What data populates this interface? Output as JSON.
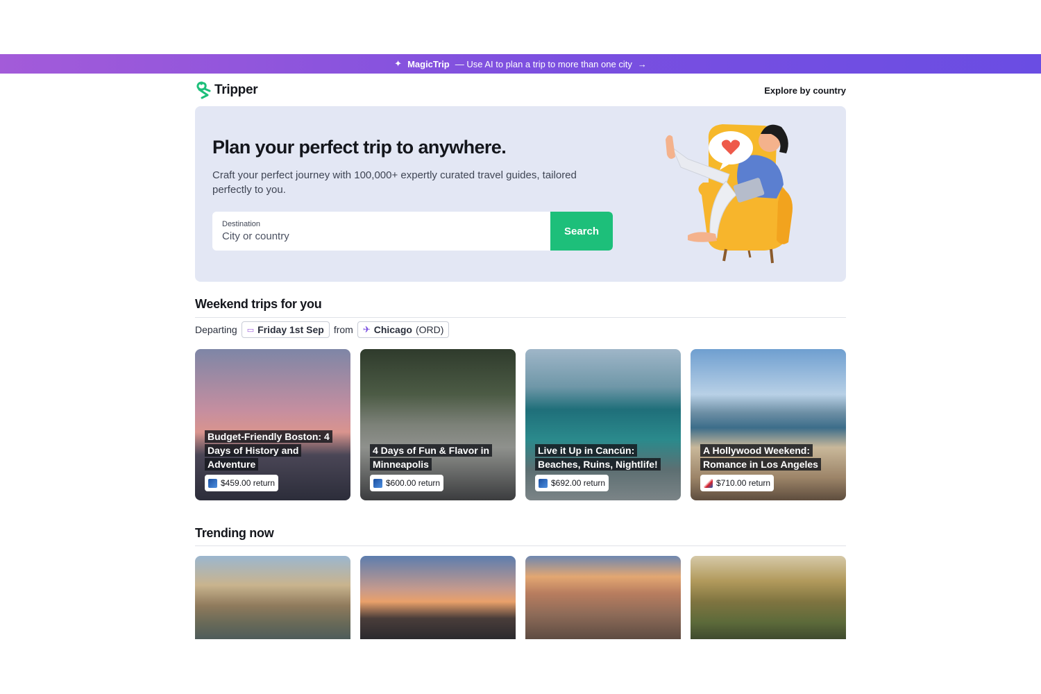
{
  "banner": {
    "brand": "MagicTrip",
    "text": "— Use AI to plan a trip to more than one city",
    "icon": "sparkle-icon",
    "arrow_icon": "arrow-right-icon"
  },
  "header": {
    "logo_text": "Tripper",
    "nav_link": "Explore by country"
  },
  "hero": {
    "title": "Plan your perfect trip to anywhere.",
    "subtitle": "Craft your perfect journey with 100,000+ expertly curated travel guides, tailored perfectly to you.",
    "search": {
      "label": "Destination",
      "placeholder": "City or country",
      "value": "",
      "button_label": "Search"
    }
  },
  "weekend": {
    "title": "Weekend trips for you",
    "departing_label": "Departing",
    "date": "Friday 1st Sep",
    "from_label": "from",
    "city": "Chicago",
    "airport": "(ORD)",
    "cards": [
      {
        "title": "Budget-Friendly Boston: 4 Days of History and Adventure",
        "price": "$459.00 return",
        "airline_icon": "united-airlines-icon"
      },
      {
        "title": "4 Days of Fun & Flavor in Minneapolis",
        "price": "$600.00 return",
        "airline_icon": "united-airlines-icon"
      },
      {
        "title": "Live it Up in Cancún: Beaches, Ruins, Nightlife!",
        "price": "$692.00 return",
        "airline_icon": "united-airlines-icon"
      },
      {
        "title": "A Hollywood Weekend: Romance in Los Angeles",
        "price": "$710.00 return",
        "airline_icon": "american-airlines-icon"
      }
    ]
  },
  "trending": {
    "title": "Trending now"
  },
  "colors": {
    "accent_green": "#1dbf7a",
    "banner_start": "#a35bd9",
    "banner_end": "#6a4de3",
    "hero_bg": "#e3e7f4"
  }
}
